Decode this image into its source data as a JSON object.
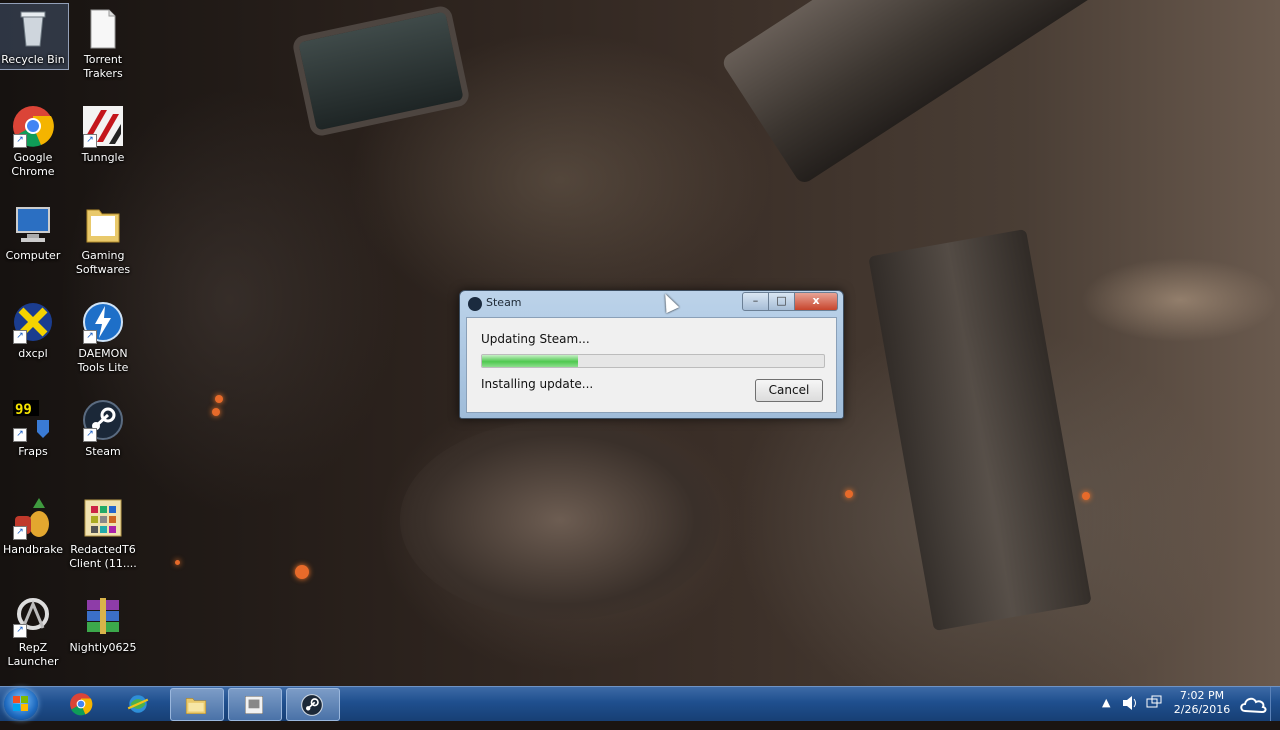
{
  "desktop_icons": [
    {
      "label": "Recycle Bin",
      "icon": "recycle-bin-icon"
    },
    {
      "label": "Torrent Trakers",
      "icon": "document-icon"
    },
    {
      "label": "Google Chrome",
      "icon": "chrome-icon"
    },
    {
      "label": "Tunngle",
      "icon": "tunngle-icon"
    },
    {
      "label": "Computer",
      "icon": "computer-icon"
    },
    {
      "label": "Gaming Softwares",
      "icon": "folder-icon"
    },
    {
      "label": "dxcpl",
      "icon": "dxcpl-icon"
    },
    {
      "label": "DAEMON Tools Lite",
      "icon": "daemon-tools-icon"
    },
    {
      "label": "Fraps",
      "icon": "fraps-icon"
    },
    {
      "label": "Steam",
      "icon": "steam-icon"
    },
    {
      "label": "Handbrake",
      "icon": "handbrake-icon"
    },
    {
      "label": "RedactedT6 Client (11....",
      "icon": "redacted-icon"
    },
    {
      "label": "RepZ Launcher",
      "icon": "repz-icon"
    },
    {
      "label": "Nightly0625",
      "icon": "winrar-icon"
    }
  ],
  "dialog": {
    "title": "Steam",
    "status": "Updating Steam...",
    "detail": "Installing update...",
    "cancel_label": "Cancel",
    "progress": 0.28,
    "minimize_glyph": "–",
    "maximize_glyph": "□",
    "close_glyph": "x"
  },
  "taskbar": {
    "pinned": [
      "chrome-icon",
      "network-globe-icon",
      "explorer-folder-icon",
      "media-window-icon",
      "steam-icon"
    ],
    "active_index": 4
  },
  "tray": {
    "time": "7:02 PM",
    "date": "2/26/2016",
    "show_hidden_glyph": "▲"
  },
  "colors": {
    "taskbar": "#1f4f8e",
    "progress": "#4fc84f",
    "dialog_frame": "#bcd3ea"
  }
}
